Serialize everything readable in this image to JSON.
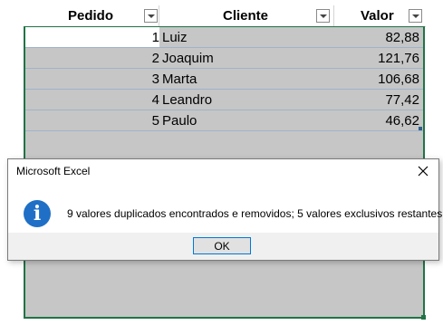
{
  "table": {
    "headers": {
      "pedido": "Pedido",
      "cliente": "Cliente",
      "valor": "Valor"
    },
    "rows": [
      {
        "pedido": "1",
        "cliente": "Luiz",
        "valor": "82,88"
      },
      {
        "pedido": "2",
        "cliente": "Joaquim",
        "valor": "121,76"
      },
      {
        "pedido": "3",
        "cliente": "Marta",
        "valor": "106,68"
      },
      {
        "pedido": "4",
        "cliente": "Leandro",
        "valor": "77,42"
      },
      {
        "pedido": "5",
        "cliente": "Paulo",
        "valor": "46,62"
      }
    ]
  },
  "dialog": {
    "title": "Microsoft Excel",
    "message": "9 valores duplicados encontrados e removidos; 5 valores exclusivos restantes.",
    "ok_label": "OK",
    "icon": "info-icon",
    "close_icon": "close-icon"
  },
  "colors": {
    "selection_border": "#217346",
    "info_icon": "#1f6fc6",
    "ok_border": "#0078d7"
  }
}
